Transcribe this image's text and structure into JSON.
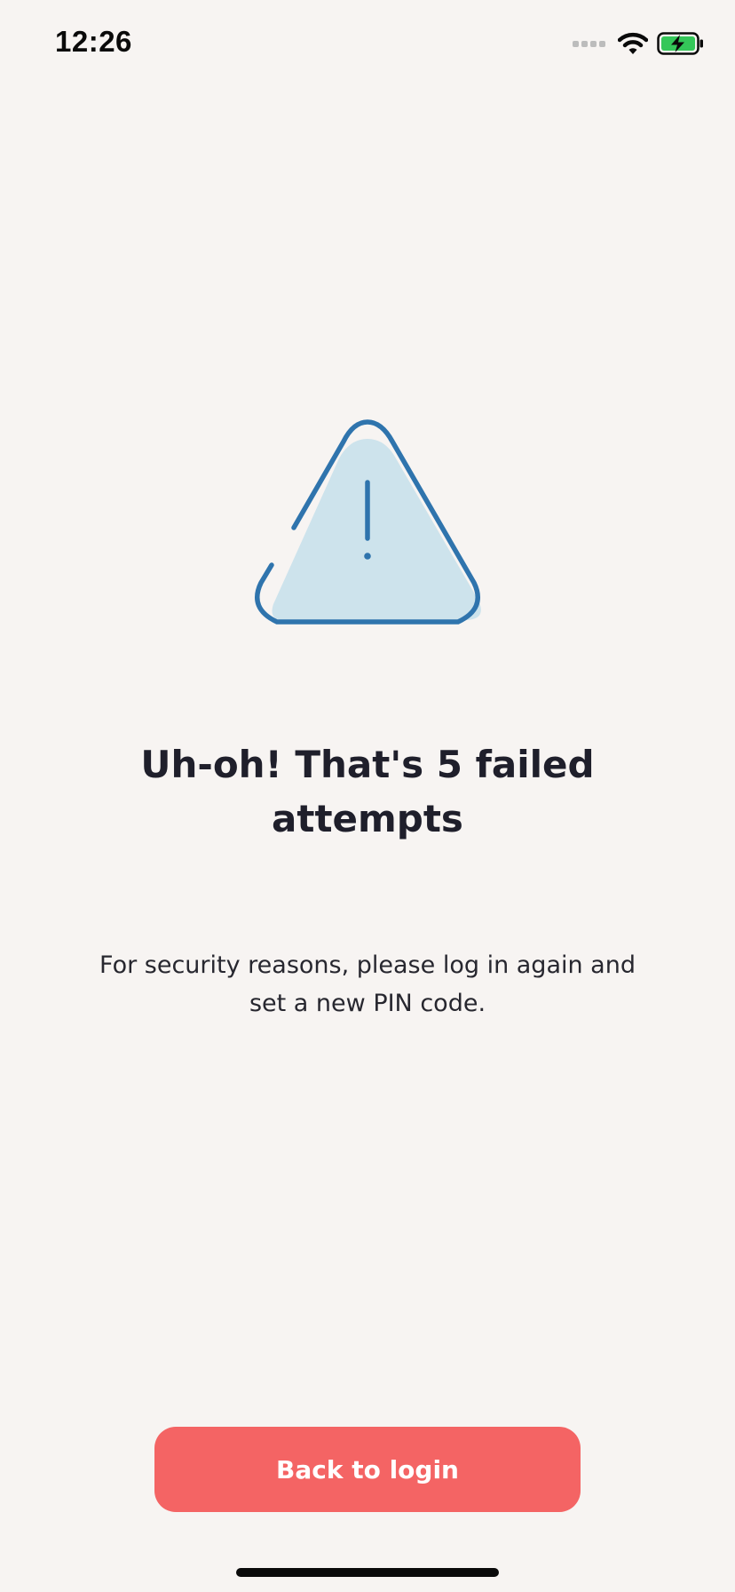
{
  "status_bar": {
    "time": "12:26",
    "icons": [
      "cellular-signal-icon",
      "wifi-icon",
      "battery-charging-icon"
    ]
  },
  "error_screen": {
    "icon": "warning-triangle-icon",
    "title": "Uh-oh! That's 5 failed attempts",
    "message": "For security reasons, please log in again and set a new PIN code.",
    "button_label": "Back to login"
  },
  "colors": {
    "background": "#f7f4f2",
    "title_text": "#1f1f2b",
    "icon_stroke": "#2f74ad",
    "icon_fill": "#cde3ec",
    "button_background": "#f46464",
    "button_text": "#ffffff",
    "battery_fill": "#34c759"
  }
}
